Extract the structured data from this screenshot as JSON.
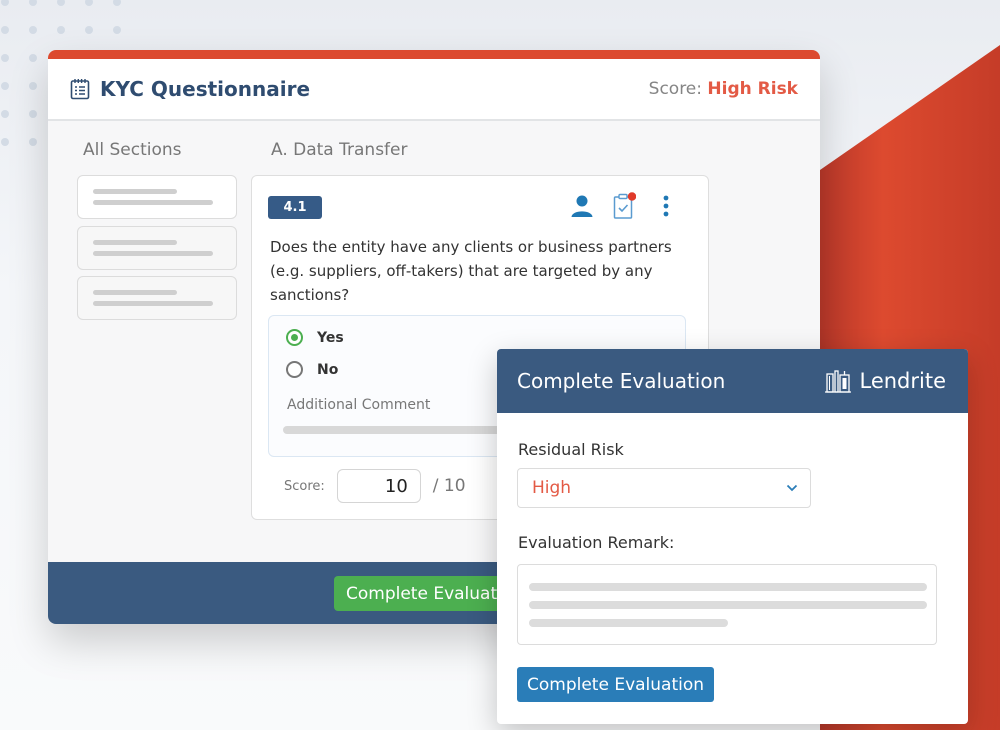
{
  "kyc": {
    "title": "KYC Questionnaire",
    "score_label": "Score:",
    "score_value": "High Risk",
    "sections_heading": "All Sections",
    "current_section": "A. Data Transfer",
    "question": {
      "number": "4.1",
      "text": "Does the entity have any clients or business partners (e.g. suppliers, off-takers) that are targeted by any sanctions?",
      "options": [
        {
          "label": "Yes",
          "selected": true
        },
        {
          "label": "No",
          "selected": false
        }
      ],
      "comment_label": "Additional Comment",
      "score_label": "Score:",
      "score_value": "10",
      "score_max": "/ 10"
    },
    "footer_button": "Complete Evaluation"
  },
  "modal": {
    "title": "Complete Evaluation",
    "brand": "Lendrite",
    "residual_risk_label": "Residual Risk",
    "residual_risk_value": "High",
    "remark_label": "Evaluation Remark:",
    "submit_label": "Complete Evaluation"
  },
  "colors": {
    "accent_red": "#dc4a2f",
    "navy": "#3a5a80",
    "risk_red": "#e35a45",
    "green": "#4caf50",
    "blue_button": "#2a7db8"
  }
}
